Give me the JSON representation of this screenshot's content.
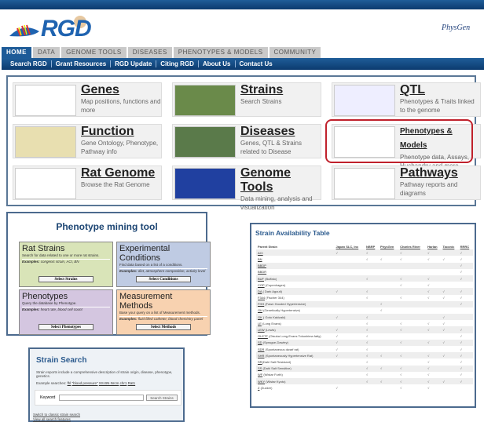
{
  "header": {
    "logo": "RGD",
    "partner_logo": "PhysGen"
  },
  "tabs": [
    "HOME",
    "DATA",
    "GENOME TOOLS",
    "DISEASES",
    "PHENOTYPES & MODELS",
    "COMMUNITY"
  ],
  "subnav": [
    "Search RGD",
    "Grant Resources",
    "RGD Update",
    "Citing RGD",
    "About Us",
    "Contact Us"
  ],
  "tiles": [
    {
      "title": "Genes",
      "desc": "Map positions, functions and more"
    },
    {
      "title": "Strains",
      "desc": "Search Strains"
    },
    {
      "title": "QTL",
      "desc": "Phenotypes & Traits linked to the genome"
    },
    {
      "title": "Function",
      "desc": "Gene Ontology, Phenotype, Pathway info"
    },
    {
      "title": "Diseases",
      "desc": "Genes, QTL & Strains related to Disease"
    },
    {
      "title": "Phenotypes & Models",
      "desc": "Phenotype data, Assays, Husbandry and more"
    },
    {
      "title": "Rat Genome",
      "desc": "Browse the Rat Genome"
    },
    {
      "title": "Genome Tools",
      "desc": "Data mining, analysis and visualization"
    },
    {
      "title": "Pathways",
      "desc": "Pathway reports and diagrams"
    }
  ],
  "highlight_color": "#c0212c",
  "pmt": {
    "title": "Phenotype mining tool",
    "boxes": [
      {
        "title": "Rat Strains",
        "desc": "Search for data related to one or more rat strains.",
        "examples_label": "Examples:",
        "examples": " congenic strain, ACI, BN",
        "button": "Select Strains",
        "color": "#d9e4b8"
      },
      {
        "title": "Experimental Conditions",
        "desc": "Find data based on a list of a conditions.",
        "examples_label": "Examples:",
        "examples": " diet, atmosphere composition, activity level",
        "button": "Select Conditions",
        "color": "#bfcbe3"
      },
      {
        "title": "Phenotypes",
        "desc": "Query the database by Phenotype.",
        "examples_label": "Examples:",
        "examples": " heart rate, blood cell count",
        "button": "Select Phenotypes",
        "color": "#d4c6e0"
      },
      {
        "title": "Measurement Methods",
        "desc": "Base your query on a list of Measurement methods.",
        "examples_label": "Examples:",
        "examples": " fluid filled catheter, blood chemistry panel",
        "button": "Select Methods",
        "color": "#f8d2b0"
      }
    ]
  },
  "strain_search": {
    "title": "Strain Search",
    "desc": "Strain reports include a comprehensive description of strain origin, disease, phenotype, genetics.",
    "example_label": "Example searches:",
    "examples": [
      "fhl",
      "\"blood pressure\"",
      "SS.BN.Nrcm",
      "chr1",
      "Rat1"
    ],
    "keyword_label": "Keyword",
    "keyword_value": "",
    "button": "Search Strains",
    "link1": "Switch to classic strain search",
    "link2": "View all search features"
  },
  "sat": {
    "title": "Strain Availability Table",
    "columns": [
      "Parent Strain",
      "Japan SLC, Inc",
      "NBRP",
      "PhysGen",
      "Charles River",
      "Harlan",
      "Taconic",
      "RRRC"
    ],
    "check": "√",
    "rows": [
      {
        "code": "ACI",
        "name": "",
        "avail": [
          1,
          1,
          0,
          1,
          1,
          0,
          1
        ]
      },
      {
        "code": "BN",
        "name": "",
        "avail": [
          0,
          1,
          1,
          1,
          1,
          1,
          1
        ]
      },
      {
        "code": "BBDP",
        "name": "",
        "avail": [
          0,
          0,
          0,
          0,
          0,
          0,
          1
        ]
      },
      {
        "code": "BBDR",
        "name": "",
        "avail": [
          0,
          0,
          0,
          0,
          0,
          0,
          1
        ]
      },
      {
        "code": "BUF",
        "name": " (Buffalo)",
        "avail": [
          0,
          1,
          0,
          1,
          1,
          0,
          1
        ]
      },
      {
        "code": "COP",
        "name": " (Copenhagen)",
        "avail": [
          0,
          0,
          0,
          1,
          1,
          0,
          0
        ]
      },
      {
        "code": "DA",
        "name": " ( Dark Agouti)",
        "avail": [
          1,
          1,
          0,
          0,
          1,
          1,
          1
        ]
      },
      {
        "code": "F344",
        "name": " (Fischer 344)",
        "avail": [
          0,
          1,
          0,
          1,
          1,
          1,
          1
        ]
      },
      {
        "code": "FHH",
        "name": " (Fawn Hooded Hypertensive)",
        "avail": [
          0,
          0,
          1,
          0,
          0,
          0,
          1
        ]
      },
      {
        "code": "GH",
        "name": " (Genetically Hypertensive)",
        "avail": [
          0,
          0,
          1,
          0,
          0,
          0,
          0
        ]
      },
      {
        "code": "GK",
        "name": " ( Goto Kakizaki)",
        "avail": [
          1,
          1,
          0,
          0,
          0,
          1,
          0
        ]
      },
      {
        "code": "LE",
        "name": " (Long Evans)",
        "avail": [
          0,
          1,
          0,
          1,
          1,
          1,
          0
        ]
      },
      {
        "code": "LEW",
        "name": " (Lewis)",
        "avail": [
          1,
          1,
          0,
          1,
          1,
          1,
          1
        ]
      },
      {
        "code": "OLETF",
        "name": " (Otsuka Long-Evans Tokushima fatty)",
        "avail": [
          1,
          1,
          0,
          0,
          0,
          0,
          1
        ]
      },
      {
        "code": "SD",
        "name": " (Sprague-Dawley)",
        "avail": [
          1,
          1,
          0,
          1,
          1,
          1,
          1
        ]
      },
      {
        "code": "SDR",
        "name": " (Spontaneous dwarf rat)",
        "avail": [
          1,
          1,
          0,
          0,
          0,
          0,
          1
        ]
      },
      {
        "code": "SHR",
        "name": " (Spontaneously Hypertensive Rat)",
        "avail": [
          1,
          1,
          1,
          1,
          1,
          1,
          1
        ]
      },
      {
        "code": "SR",
        "name": "(Dahl Salt Resistant)",
        "avail": [
          0,
          1,
          0,
          0,
          1,
          0,
          1
        ]
      },
      {
        "code": "SS",
        "name": " (Dahl Salt Sensitive)",
        "avail": [
          0,
          1,
          1,
          1,
          1,
          0,
          1
        ]
      },
      {
        "code": "WF",
        "name": " (Wistar Furth)",
        "avail": [
          0,
          1,
          0,
          1,
          1,
          0,
          1
        ]
      },
      {
        "code": "WKY",
        "name": " (Wistar Kyoto)",
        "avail": [
          0,
          1,
          1,
          1,
          1,
          1,
          1
        ]
      },
      {
        "code": "Z",
        "name": " (Zucker)",
        "avail": [
          1,
          0,
          0,
          1,
          1,
          0,
          0
        ]
      }
    ]
  }
}
